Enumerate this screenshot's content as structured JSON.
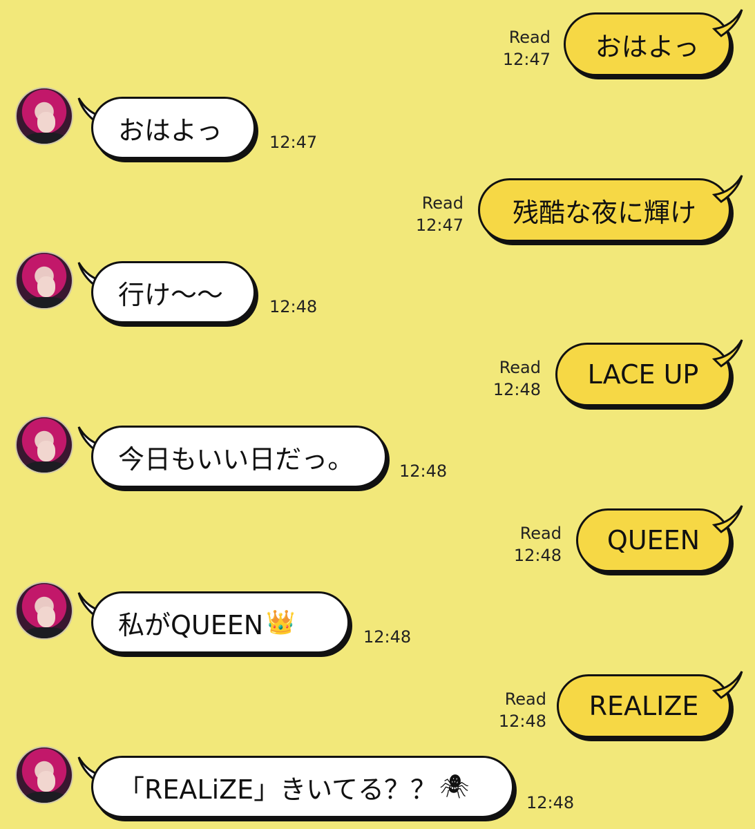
{
  "messages": [
    {
      "dir": "out",
      "text": "おはよっ",
      "read": "Read",
      "time": "12:47"
    },
    {
      "dir": "in",
      "text": "おはよっ",
      "time": "12:47"
    },
    {
      "dir": "out",
      "text": "残酷な夜に輝け",
      "read": "Read",
      "time": "12:47"
    },
    {
      "dir": "in",
      "text": "行け〜〜",
      "time": "12:48"
    },
    {
      "dir": "out",
      "text": "LACE UP",
      "read": "Read",
      "time": "12:48"
    },
    {
      "dir": "in",
      "text": "今日もいい日だっ。",
      "time": "12:48"
    },
    {
      "dir": "out",
      "text": "QUEEN",
      "read": "Read",
      "time": "12:48"
    },
    {
      "dir": "in",
      "text": "私がQUEEN",
      "emoji": "👑",
      "time": "12:48"
    },
    {
      "dir": "out",
      "text": "REALIZE",
      "read": "Read",
      "time": "12:48"
    },
    {
      "dir": "in",
      "text": "「REALiZE」きいてる？？",
      "emoji": "🕷",
      "time": "12:48"
    }
  ],
  "colors": {
    "background": "#f2e87a",
    "outgoing_bubble": "#f6d845",
    "incoming_bubble": "#ffffff"
  }
}
